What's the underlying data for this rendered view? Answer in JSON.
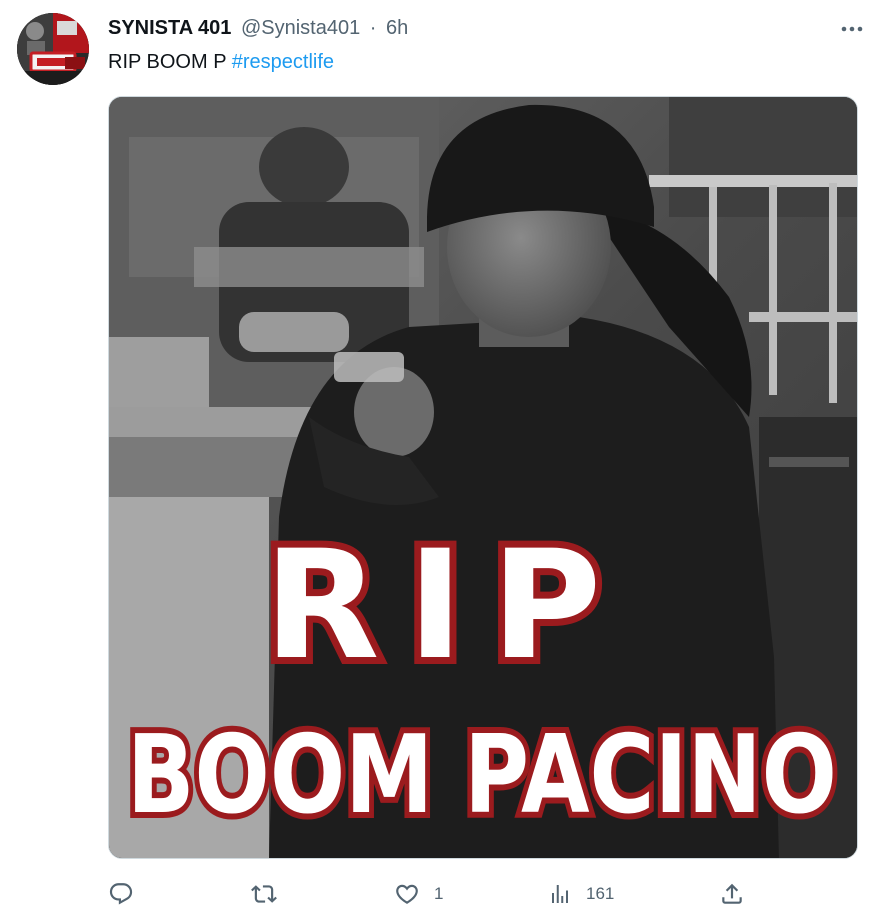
{
  "author": {
    "display_name": "SYNISTA 401",
    "handle": "@Synista401",
    "separator": "·",
    "time": "6h"
  },
  "tweet": {
    "text": "RIP BOOM P",
    "hashtag": "#respectlife"
  },
  "media": {
    "overlay_line1": "RIP",
    "overlay_line2": "BOOM PACINO",
    "overlay_fill": "#ffffff",
    "overlay_stroke": "#9b1b1e"
  },
  "actions": {
    "reply_count": "",
    "retweet_count": "",
    "like_count": "1",
    "views_count": "161"
  },
  "colors": {
    "text": "#0f1419",
    "muted": "#536471",
    "link": "#1d9bf0"
  },
  "icons": {
    "more": "more-horizontal-icon",
    "reply": "reply-icon",
    "retweet": "retweet-icon",
    "like": "heart-icon",
    "views": "views-chart-icon",
    "share": "share-icon"
  }
}
